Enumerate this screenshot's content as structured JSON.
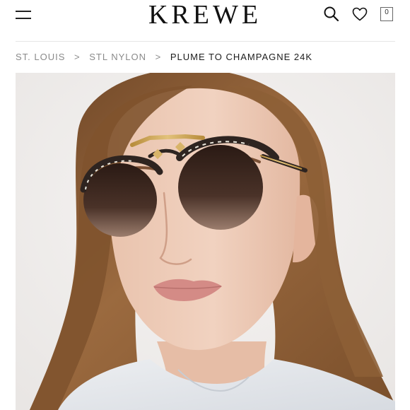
{
  "header": {
    "brand": "KREWE",
    "menu_icon": "hamburger-menu-icon",
    "search_icon": "search-icon",
    "wishlist_icon": "heart-icon",
    "cart_icon": "shopping-bag-icon",
    "cart_count": "0"
  },
  "breadcrumb": {
    "items": [
      {
        "label": "ST. LOUIS"
      },
      {
        "label": "STL NYLON"
      }
    ],
    "separator": ">",
    "current": "PLUME TO CHAMPAGNE 24K"
  },
  "product": {
    "image": "model-wearing-sunglasses",
    "colors": {
      "frame_gold": "#c9a45a",
      "lens": "#3a2a22",
      "hair": "#8a5a33"
    }
  }
}
